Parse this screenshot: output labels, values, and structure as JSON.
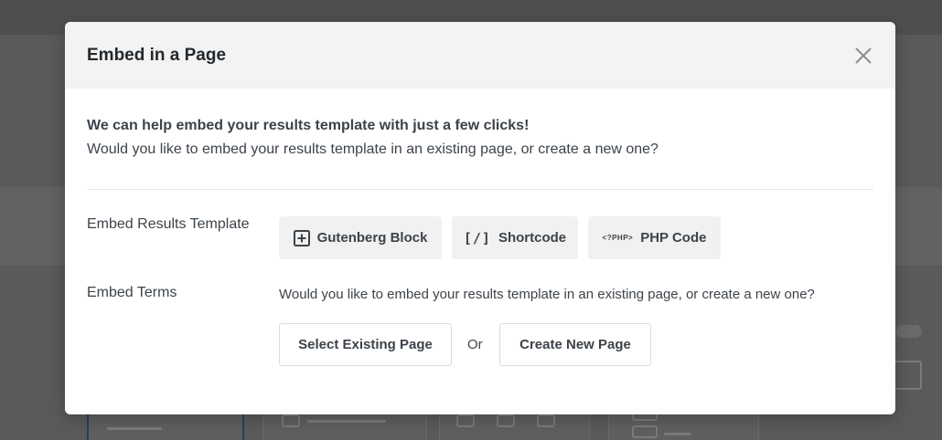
{
  "modal": {
    "title": "Embed in a Page",
    "intro_strong": "We can help embed your results template with just a few clicks!",
    "intro_text": "Would you like to embed your results template in an existing page, or create a new one?",
    "embed_results": {
      "label": "Embed Results Template",
      "options": [
        {
          "icon": "plus-square-icon",
          "label": "Gutenberg Block"
        },
        {
          "icon": "shortcode-icon",
          "icon_text": "[/]",
          "label": "Shortcode"
        },
        {
          "icon": "php-icon",
          "icon_text": "<?PHP>",
          "label": "PHP Code"
        }
      ]
    },
    "embed_terms": {
      "label": "Embed Terms",
      "text": "Would you like to embed your results template in an existing page, or create a new one?",
      "select_existing_label": "Select Existing Page",
      "or_label": "Or",
      "create_new_label": "Create New Page"
    }
  },
  "colors": {
    "overlay": "#5a5a5a",
    "header_bg": "#f3f3f3",
    "chip_bg": "#f1f1f1",
    "text": "#3c434a"
  }
}
